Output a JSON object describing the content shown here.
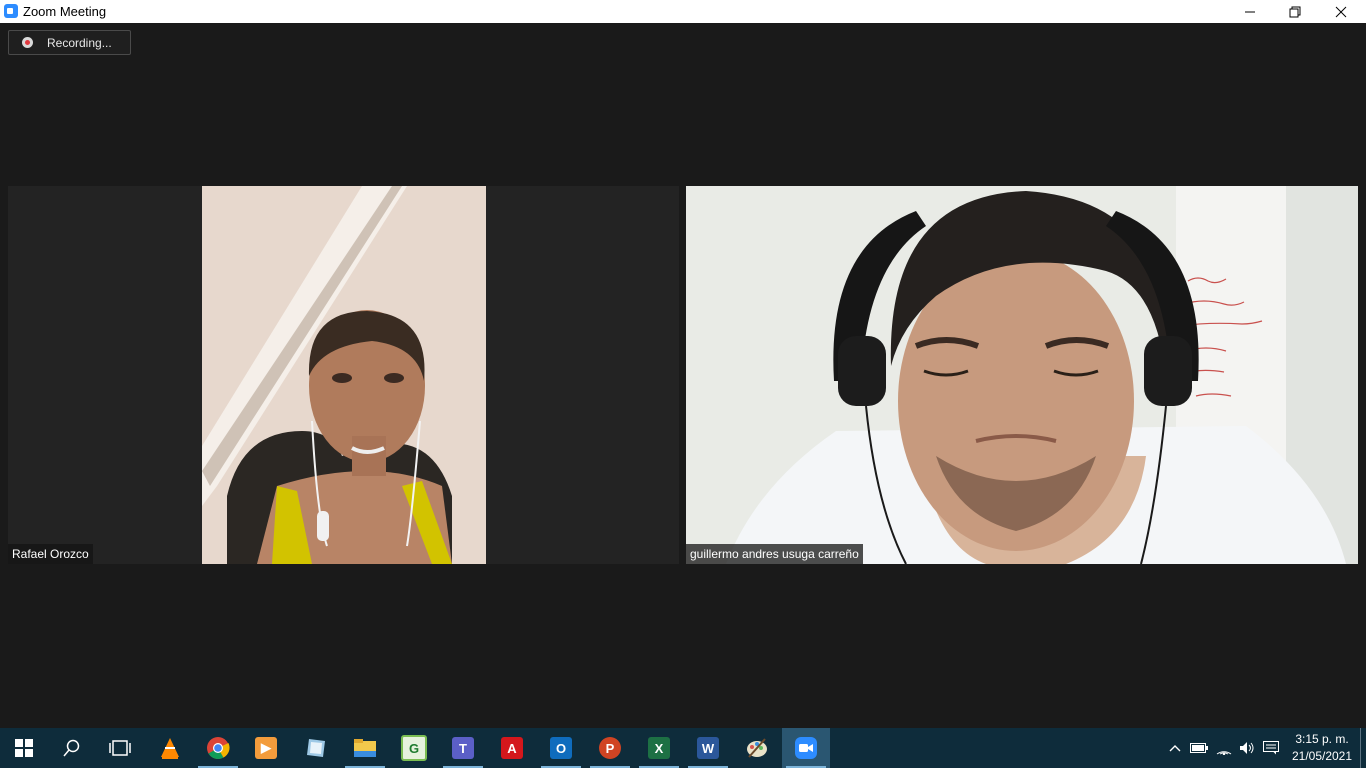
{
  "window": {
    "title": "Zoom Meeting"
  },
  "meeting": {
    "recording_label": "Recording..."
  },
  "participants": [
    {
      "name": "Rafael Orozco"
    },
    {
      "name": "guillermo andres usuga carreño"
    }
  ],
  "taskbar": {
    "pinned": [
      "start-icon",
      "search-icon",
      "task-view-icon",
      "vlc-icon",
      "chrome-icon",
      "media-player-icon",
      "notepad-icon",
      "file-explorer-icon",
      "geogebra-icon",
      "teams-icon",
      "acrobat-icon",
      "outlook-icon",
      "powerpoint-icon",
      "excel-icon",
      "word-icon",
      "paint-icon",
      "zoom-icon"
    ],
    "clock": {
      "time": "3:15 p. m.",
      "date": "21/05/2021"
    }
  },
  "colors": {
    "zoom_blue": "#2d8cff",
    "taskbar": "#0e2c3b",
    "recording_red": "#e0383e"
  }
}
